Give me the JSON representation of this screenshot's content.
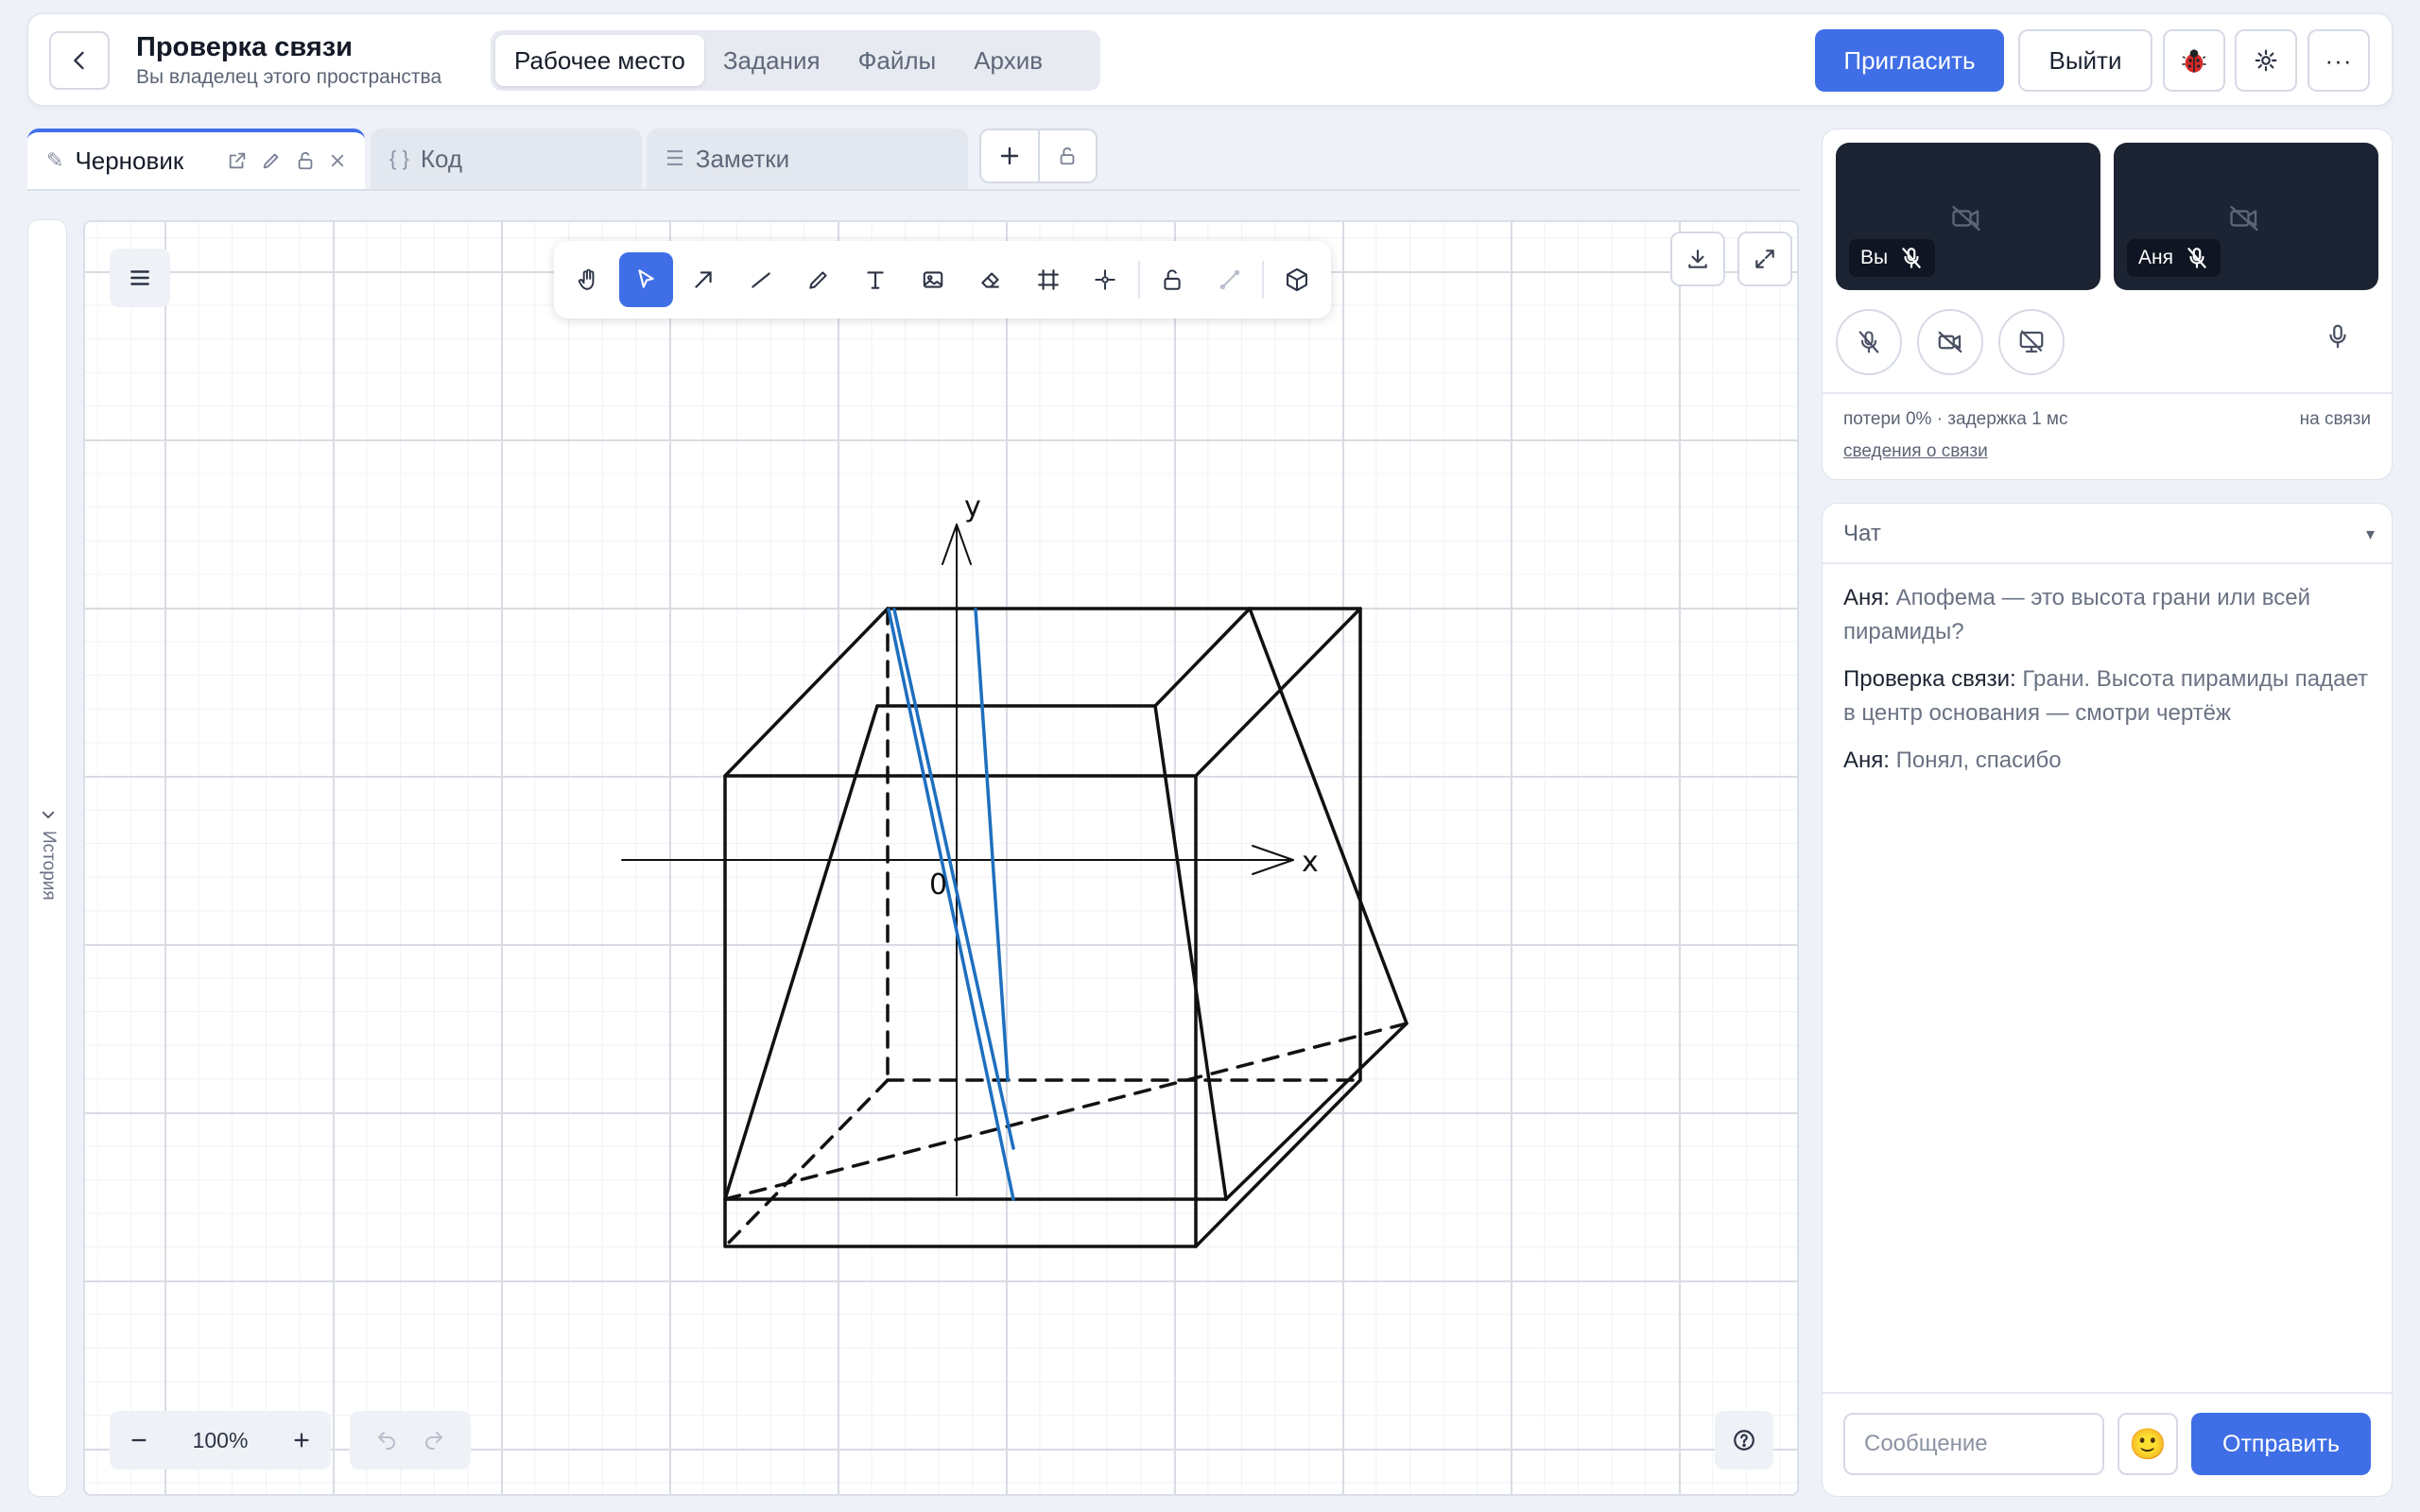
{
  "header": {
    "title": "Проверка связи",
    "subtitle": "Вы владелец этого пространства",
    "nav_tabs": [
      {
        "label": "Рабочее место",
        "active": true
      },
      {
        "label": "Задания",
        "active": false
      },
      {
        "label": "Файлы",
        "active": false
      },
      {
        "label": "Архив",
        "active": false
      }
    ],
    "invite_label": "Пригласить",
    "exit_label": "Выйти",
    "more_label": "···",
    "accent_color": "#3f6ee6"
  },
  "doc_tabs": [
    {
      "label": "Черновик",
      "glyph": "✎",
      "active": true
    },
    {
      "label": "Код",
      "glyph": "{ }",
      "active": false
    },
    {
      "label": "Заметки",
      "glyph": "☰",
      "active": false
    }
  ],
  "history": {
    "label": "История"
  },
  "canvas": {
    "zoom": "100%",
    "axis_labels": {
      "x": "x",
      "y": "y",
      "origin": "0"
    },
    "tools": [
      "hand-icon",
      "pointer-icon",
      "arrow-icon",
      "line-icon",
      "pencil-icon",
      "text-icon",
      "image-icon",
      "eraser-icon",
      "frame-icon",
      "point-icon",
      "lock-icon",
      "connector-icon",
      "cube-icon"
    ],
    "active_tool": "pointer-icon",
    "stroke_colors": {
      "shape": "#111111",
      "highlight": "#1e6fbf"
    }
  },
  "video": {
    "participants": [
      {
        "name": "Вы",
        "muted": true
      },
      {
        "name": "Аня",
        "muted": true
      }
    ],
    "stats": "потери 0% · задержка 1 мс",
    "status": "на связи",
    "details_link": "сведения о связи"
  },
  "chat": {
    "title": "Чат",
    "caret": "▾",
    "messages": [
      {
        "author": "Аня:",
        "text": "Апофема — это высота грани или всей пирамиды?"
      },
      {
        "author": "Проверка связи:",
        "text": "Грани. Высота пирамиды падает в центр основания — смотри чертёж"
      },
      {
        "author": "Аня:",
        "text": "Понял, спасибо"
      }
    ],
    "input_placeholder": "Сообщение",
    "emoji": "🙂",
    "send_label": "Отправить"
  }
}
